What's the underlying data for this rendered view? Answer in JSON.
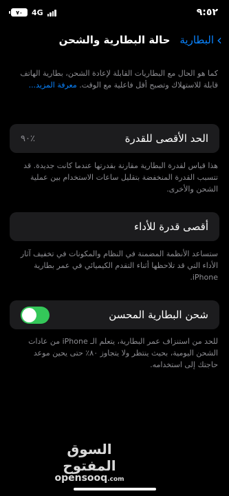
{
  "status_bar": {
    "time": "٩:٥٢",
    "network": "4G",
    "battery_label": "٧٠"
  },
  "nav": {
    "back_label": "البطارية",
    "title": "حالة البطارية والشحن"
  },
  "intro": {
    "text": "كما هو الحال مع البطاريات القابلة لإعادة الشحن، بطارية الهاتف قابلة للاستهلاك وتصبح أقل فاعلية مع الوقت.",
    "link": "معرفة المزيد..."
  },
  "max_capacity": {
    "label": "الحد الأقصى للقدرة",
    "value": "٪٩٠",
    "footer": "هذا قياس لقدرة البطارية مقارنة بقدرتها عندما كانت جديدة. قد تتسبب القدرة المنخفضة بتقليل ساعات الاستخدام بين عملية الشحن والأخرى."
  },
  "peak_performance": {
    "label": "أقصى قدرة للأداء",
    "footer": "ستساعد الأنظمة المضمنة في النظام والمكونات في تخفيف آثار الأداء التي قد تلاحظها أثناء التقدم الكيميائي في عمر بطارية iPhone."
  },
  "optimized_charging": {
    "label": "شحن البطارية المحسن",
    "enabled": true,
    "toggle_color": "#34c759",
    "footer": "للحد من استنزاف عمر البطارية، يتعلم الـ iPhone من عادات الشحن اليومية، بحيث ينتظر ولا يتجاوز ٨٠٪ حتى يحين موعد حاجتك إلى استخدامه."
  },
  "watermark": {
    "arabic": "السوق المفتوح",
    "latin": "opensooq",
    "suffix": ".com"
  }
}
